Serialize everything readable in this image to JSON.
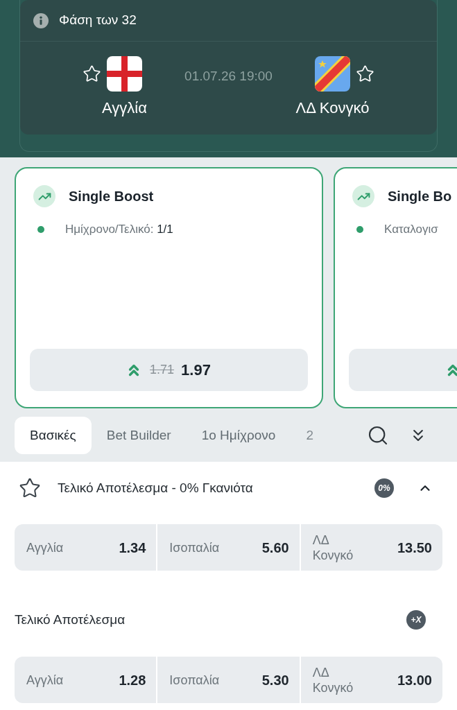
{
  "match": {
    "stage": "Φάση των 32",
    "date_time": "01.07.26 19:00",
    "teams": [
      {
        "name": "Αγγλία",
        "kind": "cross",
        "favorite": false
      },
      {
        "name": "ΛΔ Κονγκό",
        "kind": "diagonal",
        "favorite": false
      }
    ]
  },
  "boosts": [
    {
      "title": "Single Boost",
      "selection": "Ημίχρονο/Τελικό: **1/1**",
      "old_odds": "1.71",
      "new_odds": "1.97"
    },
    {
      "title": "Single Bo",
      "selection": "Καταλογισ"
    }
  ],
  "tabs": [
    {
      "label": "Βασικές",
      "selected": true
    },
    {
      "label": "Bet Builder",
      "selected": false
    },
    {
      "label": "1ο Ημίχρονο",
      "selected": false
    },
    {
      "label": "2",
      "selected": false
    }
  ],
  "markets": [
    {
      "kind": "collapsible",
      "title": "Τελικό Αποτέλεσμα - 0% Γκανιότα",
      "favorite": false,
      "badge": "0%",
      "expanded": true,
      "outcomes": [
        {
          "label": "Αγγλία",
          "odds": "1.34"
        },
        {
          "label": "Ισοπαλία",
          "odds": "5.60"
        },
        {
          "label": "ΛΔ Κονγκό",
          "odds": "13.50"
        }
      ]
    },
    {
      "kind": "plain",
      "title": "Τελικό Αποτέλεσμα",
      "badge": "+X",
      "outcomes": [
        {
          "label": "Αγγλία",
          "odds": "1.28"
        },
        {
          "label": "Ισοπαλία",
          "odds": "5.30"
        },
        {
          "label": "ΛΔ Κονγκό",
          "odds": "13.00"
        }
      ]
    }
  ]
}
